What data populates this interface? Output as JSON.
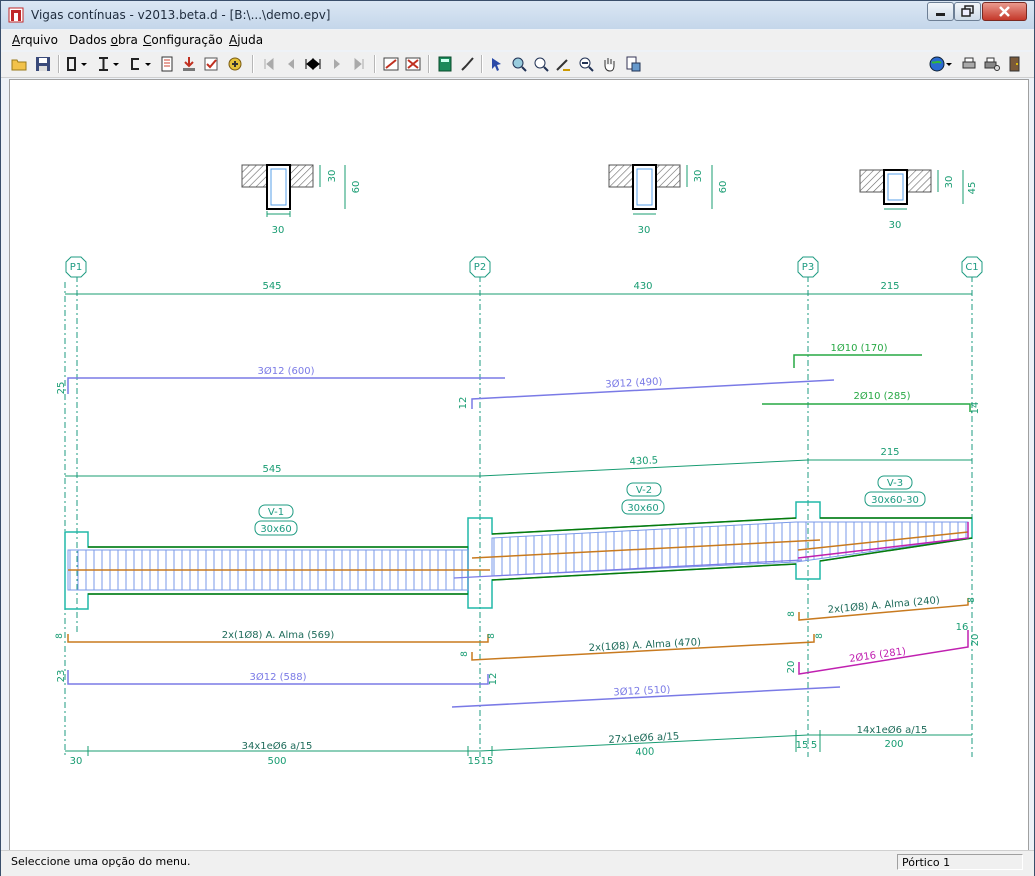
{
  "window": {
    "title": "Vigas contínuas - v2013.beta.d - [B:\\...\\demo.epv]"
  },
  "menu": [
    {
      "u": "A",
      "rest": "rquivo"
    },
    {
      "u": "",
      "rest": "Dados ",
      "u2": "o",
      "rest2": "bra"
    },
    {
      "u": "C",
      "rest": "onfiguração"
    },
    {
      "u": "A",
      "rest": "juda"
    }
  ],
  "status": {
    "message": "Seleccione uma opção do menu.",
    "panel": "Pórtico 1"
  },
  "colors": {
    "teal": "#1e9b82",
    "dimgreen": "#189c72",
    "blue": "#7a7ae6",
    "green": "#27a844",
    "orange": "#c87a1f",
    "magenta": "#c020b0",
    "darkgreen": "#0a7a0a",
    "cyan": "#20b8a8"
  },
  "drawing": {
    "sections": [
      {
        "w": "30",
        "h1": "30",
        "h2": "60"
      },
      {
        "w": "30",
        "h1": "30",
        "h2": "60"
      },
      {
        "w": "30",
        "h1": "30",
        "h2": "45"
      }
    ],
    "supports": [
      "P1",
      "P2",
      "P3",
      "C1"
    ],
    "spans_top": [
      "545",
      "430",
      "215"
    ],
    "top_bars": {
      "b1": "3Ø12 (600)",
      "b2": "3Ø12 (490)",
      "b3": "1Ø10 (170)",
      "b4": "2Ø10 (285)",
      "d25": "25",
      "d12": "12",
      "d14": "14"
    },
    "spans_mid": [
      "545",
      "430.5",
      "215"
    ],
    "beams": [
      {
        "name": "V-1",
        "size": "30x60"
      },
      {
        "name": "V-2",
        "size": "30x60"
      },
      {
        "name": "V-3",
        "size": "30x60-30"
      }
    ],
    "alma": {
      "a1": "2x(1Ø8) A. Alma (569)",
      "a2": "2x(1Ø8) A. Alma (470)",
      "a3": "2x(1Ø8) A. Alma (240)",
      "d8": "8"
    },
    "bottom_bars": {
      "b1": "3Ø12 (588)",
      "b2": "3Ø12 (510)",
      "b3": "2Ø16 (281)",
      "d23": "23",
      "d12": "12",
      "d20": "20",
      "d16": "16"
    },
    "stirrups": [
      "34x1eØ6 a/15",
      "27x1eØ6 a/15",
      "14x1eØ6 a/15"
    ],
    "bottom_dims": [
      "30",
      "500",
      "15",
      "15",
      "400",
      "15",
      "5",
      "200"
    ]
  }
}
